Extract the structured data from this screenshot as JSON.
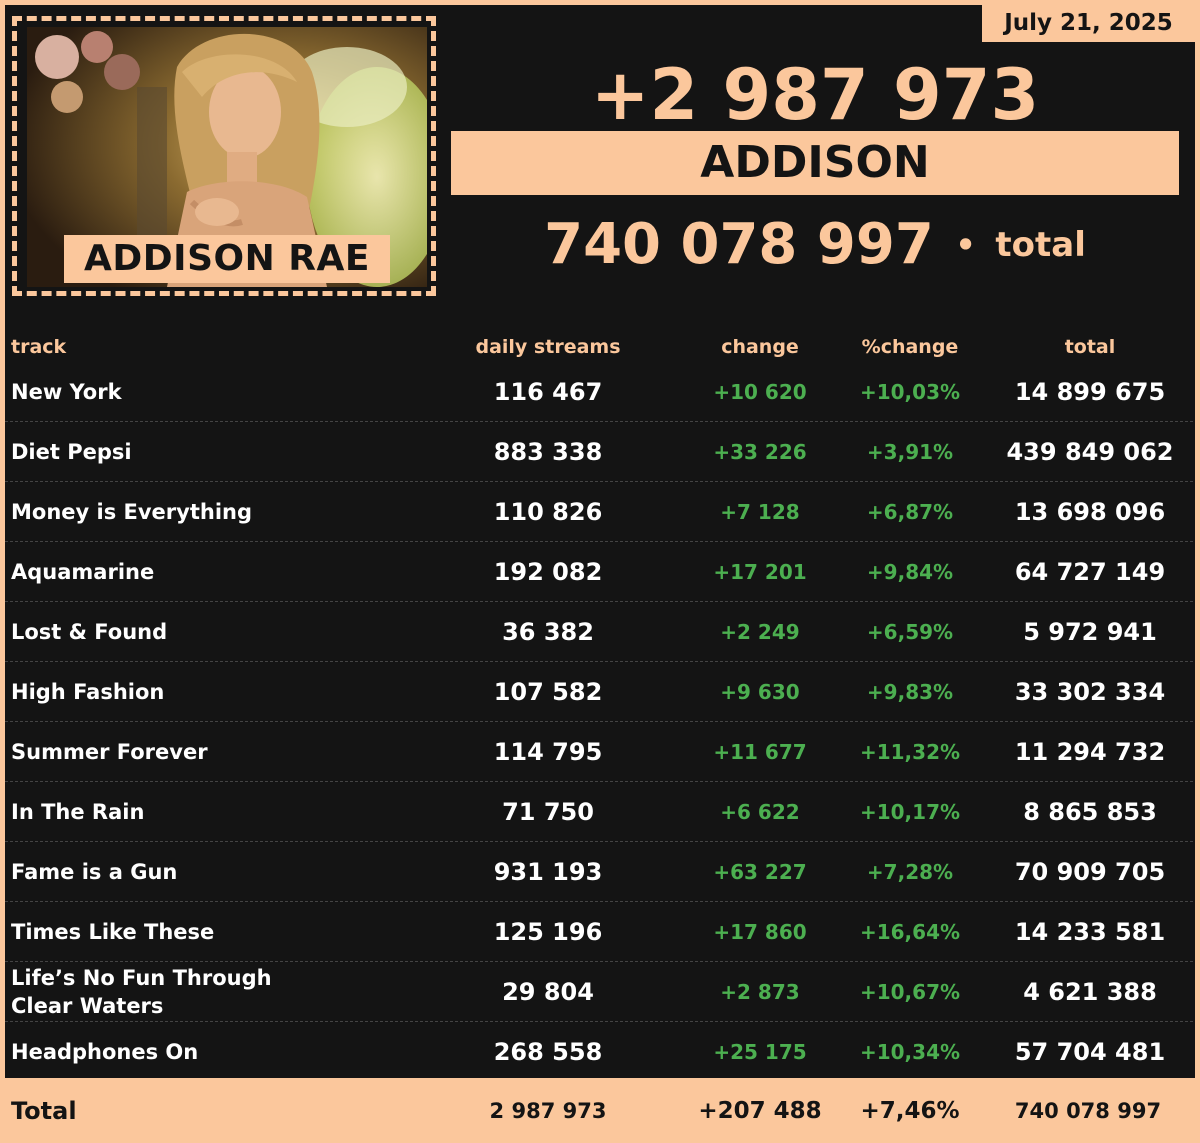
{
  "date": "July 21, 2025",
  "artist": "ADDISON RAE",
  "album": "ADDISON",
  "daily_change_total": "+2 987 973",
  "total_streams": "740 078 997",
  "total_label": "total",
  "bullet": "•",
  "table": {
    "headers": {
      "track": "track",
      "daily": "daily streams",
      "change": "change",
      "pct": "%change",
      "total": "total"
    },
    "rows": [
      {
        "track": "New York",
        "daily": "116 467",
        "change": "+10 620",
        "pct": "+10,03%",
        "total": "14 899 675"
      },
      {
        "track": "Diet Pepsi",
        "daily": "883 338",
        "change": "+33 226",
        "pct": "+3,91%",
        "total": "439 849 062"
      },
      {
        "track": "Money is Everything",
        "daily": "110 826",
        "change": "+7 128",
        "pct": "+6,87%",
        "total": "13 698 096"
      },
      {
        "track": "Aquamarine",
        "daily": "192 082",
        "change": "+17 201",
        "pct": "+9,84%",
        "total": "64 727 149"
      },
      {
        "track": "Lost & Found",
        "daily": "36 382",
        "change": "+2 249",
        "pct": "+6,59%",
        "total": "5 972 941"
      },
      {
        "track": "High Fashion",
        "daily": "107 582",
        "change": "+9 630",
        "pct": "+9,83%",
        "total": "33 302 334"
      },
      {
        "track": "Summer Forever",
        "daily": "114 795",
        "change": "+11 677",
        "pct": "+11,32%",
        "total": "11 294 732"
      },
      {
        "track": "In The Rain",
        "daily": "71 750",
        "change": "+6 622",
        "pct": "+10,17%",
        "total": "8 865 853"
      },
      {
        "track": "Fame is a Gun",
        "daily": "931 193",
        "change": "+63 227",
        "pct": "+7,28%",
        "total": "70 909 705"
      },
      {
        "track": "Times Like These",
        "daily": "125 196",
        "change": "+17 860",
        "pct": "+16,64%",
        "total": "14 233 581"
      },
      {
        "track": "Life’s No Fun Through Clear Waters",
        "daily": "29 804",
        "change": "+2 873",
        "pct": "+10,67%",
        "total": "4 621 388"
      },
      {
        "track": "Headphones On",
        "daily": "268 558",
        "change": "+25 175",
        "pct": "+10,34%",
        "total": "57 704 481"
      }
    ],
    "footer": {
      "label": "Total",
      "daily": "2 987 973",
      "change": "+207 488",
      "pct": "+7,46%",
      "total": "740 078 997"
    }
  },
  "colors": {
    "accent": "#fbc79c",
    "background": "#141414",
    "positive": "#4caf50",
    "text": "#ffffff"
  }
}
